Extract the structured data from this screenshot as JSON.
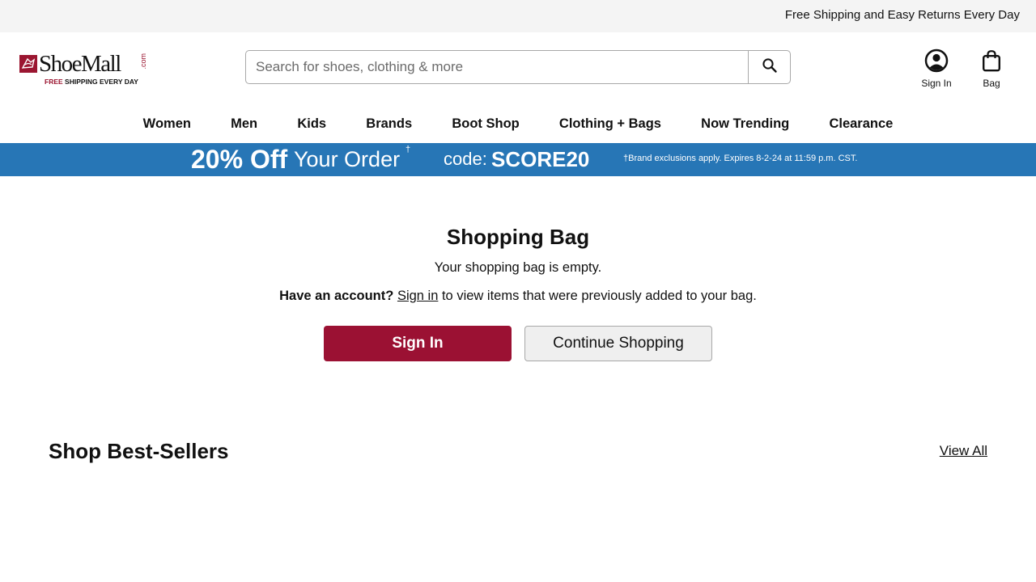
{
  "topbar": {
    "message": "Free Shipping and Easy Returns Every Day"
  },
  "header": {
    "logo": {
      "wordmark": "ShoeMall",
      "com": ".com",
      "tag_free": "FREE",
      "tag_rest": " SHIPPING EVERY DAY"
    },
    "search": {
      "placeholder": "Search for shoes, clothing & more",
      "value": ""
    },
    "account_label": "Sign In",
    "bag_label": "Bag"
  },
  "nav": {
    "items": [
      "Women",
      "Men",
      "Kids",
      "Brands",
      "Boot Shop",
      "Clothing + Bags",
      "Now Trending",
      "Clearance"
    ]
  },
  "promo": {
    "headline": "20% Off",
    "sub": "Your Order",
    "dagger": "†",
    "code_label": "code:",
    "code": "SCORE20",
    "fine_print": "†Brand exclusions apply. Expires 8-2-24 at 11:59 p.m. CST."
  },
  "bag": {
    "title": "Shopping Bag",
    "empty_message": "Your shopping bag is empty.",
    "account_prompt": "Have an account?",
    "sign_in_link": "Sign in",
    "account_suffix": " to view items that were previously added to your bag.",
    "sign_in_button": "Sign In",
    "continue_button": "Continue Shopping"
  },
  "best_sellers": {
    "title": "Shop Best-Sellers",
    "view_all": "View All"
  },
  "colors": {
    "brand": "#9b1133",
    "promo_bg": "#2776b6",
    "topbar_bg": "#f4f4f4"
  }
}
